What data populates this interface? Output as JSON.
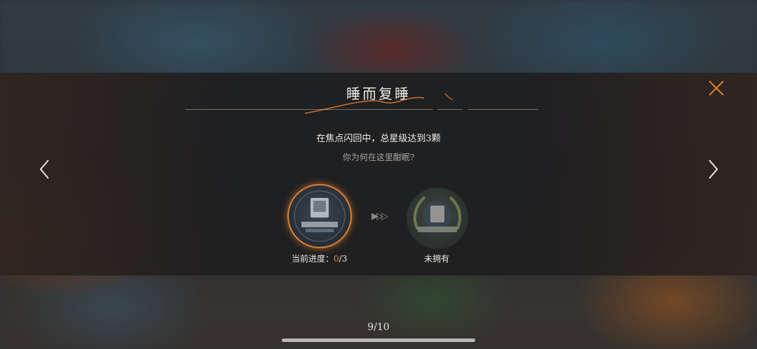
{
  "achievement": {
    "title": "睡而复睡",
    "condition": "在焦点闪回中，总星级达到3颗",
    "flavor": "你为何在这里酣眠?"
  },
  "progress": {
    "current_label_prefix": "当前进度：",
    "current_value": "0",
    "current_sep": "/3",
    "current_fraction": 0,
    "next_label": "未拥有"
  },
  "pagination": {
    "indicator": "9/10"
  },
  "icons": {
    "close": "close-icon",
    "prev": "chevron-left-icon",
    "next": "chevron-right-icon",
    "arrow": "double-arrow-right-icon",
    "medal_current": "badge-medal-icon",
    "medal_next": "laurel-badge-icon"
  },
  "colors": {
    "accent": "#e0802f",
    "text": "#f0ebe5",
    "muted": "#a8a39d"
  }
}
